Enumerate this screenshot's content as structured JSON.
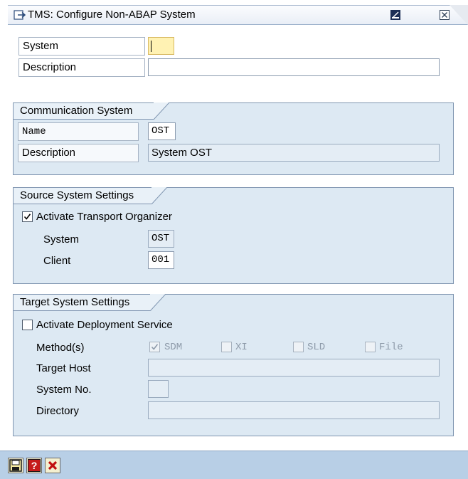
{
  "window": {
    "title": "TMS: Configure Non-ABAP System"
  },
  "header": {
    "system_label": "System",
    "system_value": "",
    "description_label": "Description",
    "description_value": ""
  },
  "communication": {
    "title": "Communication System",
    "name_label": "Name",
    "name_value": "OST",
    "description_label": "Description",
    "description_value": "System OST"
  },
  "source": {
    "title": "Source System Settings",
    "activate_label": "Activate Transport Organizer",
    "activate_checked": true,
    "system_label": "System",
    "system_value": "OST",
    "client_label": "Client",
    "client_value": "001"
  },
  "target": {
    "title": "Target System Settings",
    "activate_label": "Activate Deployment Service",
    "activate_checked": false,
    "methods_label": "Method(s)",
    "methods": [
      {
        "label": "SDM",
        "checked": true
      },
      {
        "label": "XI",
        "checked": false
      },
      {
        "label": "SLD",
        "checked": false
      },
      {
        "label": "File",
        "checked": false
      }
    ],
    "target_host_label": "Target Host",
    "target_host_value": "",
    "system_no_label": "System No.",
    "system_no_value": "",
    "directory_label": "Directory",
    "directory_value": ""
  },
  "icons": {
    "title": "window-app-icon",
    "minimize": "minimize-icon",
    "close": "close-icon",
    "save": "save-icon",
    "help": "help-icon",
    "cancel": "cancel-icon"
  },
  "colors": {
    "accent": "#b8cfe6",
    "group_bg": "#dde9f3",
    "mandatory": "#fff2b3"
  }
}
